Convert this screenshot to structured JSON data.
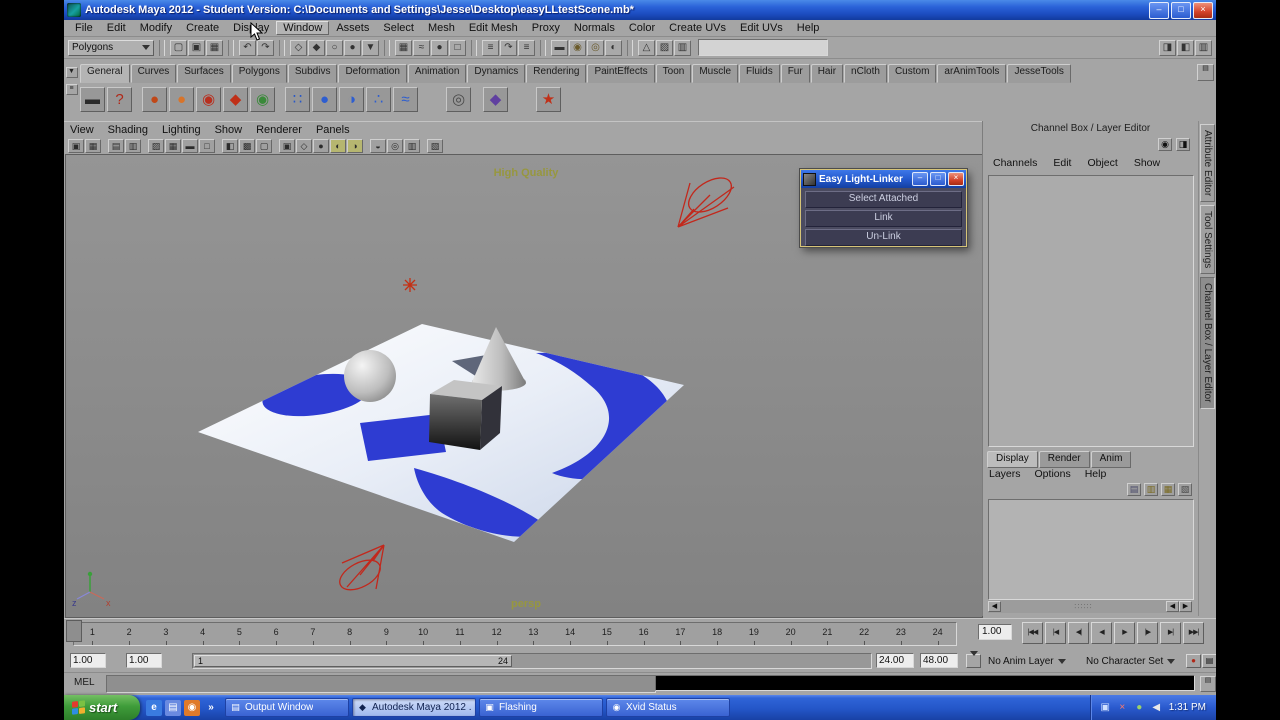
{
  "window": {
    "title": "Autodesk Maya 2012 - Student Version: C:\\Documents and Settings\\Jesse\\Desktop\\easyLLtestScene.mb*",
    "controls": {
      "minimize": "–",
      "maximize": "□",
      "close": "×"
    }
  },
  "menubar": {
    "items": [
      "File",
      "Edit",
      "Modify",
      "Create",
      "Display",
      {
        "label": "Window",
        "name": "menu-window",
        "active": true
      },
      "Assets",
      "Select",
      "Mesh",
      "Edit Mesh",
      "Proxy",
      "Normals",
      "Color",
      "Create UVs",
      "Edit UVs",
      "Help"
    ]
  },
  "statusline": {
    "mode": "Polygons",
    "file_icons": [
      {
        "name": "new-scene-icon",
        "glyph": "▢"
      },
      {
        "name": "open-scene-icon",
        "glyph": "▣"
      },
      {
        "name": "save-scene-icon",
        "glyph": "▦"
      }
    ],
    "undo_icons": [
      {
        "name": "undo-icon",
        "glyph": "↶"
      },
      {
        "name": "redo-icon",
        "glyph": "↷"
      }
    ],
    "mask_icons": [
      {
        "name": "select-hierarchy-icon",
        "glyph": "◇"
      },
      {
        "name": "select-object-icon",
        "glyph": "◆"
      },
      {
        "name": "select-component-icon",
        "glyph": "○"
      },
      {
        "name": "select-mask-icon",
        "glyph": "●"
      },
      {
        "name": "lock-selection-icon",
        "glyph": "▼"
      }
    ],
    "snap_icons": [
      {
        "name": "snap-grid-icon",
        "glyph": "▦"
      },
      {
        "name": "snap-curve-icon",
        "glyph": "≈"
      },
      {
        "name": "snap-point-icon",
        "glyph": "●"
      },
      {
        "name": "snap-plane-icon",
        "glyph": "□"
      }
    ],
    "history_icons": [
      {
        "name": "list-inputs-icon",
        "glyph": "≡"
      },
      {
        "name": "construction-history-icon",
        "glyph": "↷"
      },
      {
        "name": "list-outputs-icon",
        "glyph": "≡"
      }
    ],
    "render_icons": [
      {
        "name": "open-render-view-icon",
        "glyph": "▬"
      },
      {
        "name": "render-current-frame-icon",
        "glyph": "◉",
        "fg": "#6a5a2a"
      },
      {
        "name": "ipr-render-icon",
        "glyph": "◎",
        "fg": "#6a5a2a"
      },
      {
        "name": "render-settings-icon",
        "glyph": "◐"
      }
    ],
    "util_icons": [
      {
        "name": "paint-effects-icon",
        "glyph": "△"
      },
      {
        "name": "hypershade-icon",
        "glyph": "▨"
      },
      {
        "name": "help-line-icon",
        "glyph": "▥"
      }
    ],
    "right_icons": [
      {
        "name": "show-attribute-editor-icon",
        "glyph": "◨"
      },
      {
        "name": "show-tool-settings-icon",
        "glyph": "◧"
      },
      {
        "name": "show-channel-box-icon",
        "glyph": "▥"
      }
    ]
  },
  "shelf": {
    "left_buttons": [
      {
        "name": "shelf-tab-arrow",
        "glyph": "▼"
      },
      {
        "name": "shelf-menu-button",
        "glyph": "≡"
      }
    ],
    "tabs": [
      {
        "label": "General",
        "active": true
      },
      "Curves",
      "Surfaces",
      "Polygons",
      "Subdivs",
      "Deformation",
      "Animation",
      "Dynamics",
      "Rendering",
      "PaintEffects",
      "Toon",
      "Muscle",
      "Fluids",
      "Fur",
      "Hair",
      "nCloth",
      "Custom",
      "arAnimTools",
      "JesseTools"
    ],
    "editor_icon": {
      "glyph": "▤"
    },
    "icons": [
      {
        "name": "shelf-icon-slate",
        "glyph": "▬",
        "fg": "#2a2a2a"
      },
      {
        "name": "shelf-icon-help",
        "glyph": "?",
        "fg": "#b02818"
      },
      {
        "name": "shelf-icon-magnet-red",
        "glyph": "●",
        "fg": "#c04818",
        "gap": 8
      },
      {
        "name": "shelf-icon-magnet-orange",
        "glyph": "●",
        "fg": "#d8742a"
      },
      {
        "name": "shelf-icon-ball-red",
        "glyph": "◉",
        "fg": "#b83020"
      },
      {
        "name": "shelf-icon-comet-red",
        "glyph": "◆",
        "fg": "#c03018"
      },
      {
        "name": "shelf-icon-snap-green",
        "glyph": "◉",
        "fg": "#3a8a3a"
      },
      {
        "name": "shelf-icon-pair-blue",
        "glyph": "∷",
        "fg": "#2858c8",
        "gap": 8
      },
      {
        "name": "shelf-icon-magnet-blue",
        "glyph": "●",
        "fg": "#2e5ed0"
      },
      {
        "name": "shelf-icon-emitter-blue",
        "glyph": "◑",
        "fg": "#2e5ed0"
      },
      {
        "name": "shelf-icon-particles-blue",
        "glyph": "∴",
        "fg": "#2e5ed0"
      },
      {
        "name": "shelf-icon-field-blue",
        "glyph": "≈",
        "fg": "#2e5ed0"
      },
      {
        "name": "shelf-icon-spheres-gray",
        "glyph": "◎",
        "fg": "#4a4a4a",
        "gap": 26
      },
      {
        "name": "shelf-icon-deformer-purple",
        "glyph": "◆",
        "fg": "#6040a0",
        "gap": 10
      },
      {
        "name": "shelf-icon-star-red",
        "glyph": "★",
        "fg": "#c03018",
        "gap": 26
      }
    ]
  },
  "panel_menu": {
    "items": [
      "View",
      "Shading",
      "Lighting",
      "Show",
      "Renderer",
      "Panels"
    ]
  },
  "panel_toolbar": {
    "icons": [
      {
        "name": "single-view-icon",
        "glyph": "▣"
      },
      {
        "name": "four-view-icon",
        "glyph": "▦"
      },
      {
        "name": "camera-attributes-icon",
        "glyph": "▤",
        "gap": 6
      },
      {
        "name": "bookmarks-icon",
        "glyph": "▥"
      },
      {
        "name": "image-plane-icon",
        "glyph": "▨",
        "gap": 6
      },
      {
        "name": "grid-toggle-icon",
        "glyph": "▦"
      },
      {
        "name": "film-gate-icon",
        "glyph": "▬"
      },
      {
        "name": "resolution-gate-icon",
        "glyph": "□"
      },
      {
        "name": "gate-mask-icon",
        "glyph": "◧",
        "gap": 6
      },
      {
        "name": "field-chart-icon",
        "glyph": "▩"
      },
      {
        "name": "safe-action-icon",
        "glyph": "▢"
      },
      {
        "name": "safe-title-icon",
        "glyph": "▣",
        "gap": 6
      },
      {
        "name": "wireframe-mode-icon",
        "glyph": "◇"
      },
      {
        "name": "shaded-mode-icon",
        "glyph": "●"
      },
      {
        "name": "textured-mode-icon",
        "glyph": "◐",
        "bg": "#b6b670"
      },
      {
        "name": "use-all-lights-icon",
        "glyph": "◑",
        "bg": "#b6b670"
      },
      {
        "name": "shadows-icon",
        "glyph": "◒",
        "gap": 6
      },
      {
        "name": "isolate-select-icon",
        "glyph": "◎"
      },
      {
        "name": "xray-icon",
        "glyph": "▥"
      },
      {
        "name": "plugin-shapes-icon",
        "glyph": "▧",
        "gap": 6
      }
    ]
  },
  "viewport": {
    "hud": "High Quality",
    "camera": "persp",
    "axis_x": "x",
    "axis_z": "z"
  },
  "light_linker": {
    "title": "Easy Light-Linker",
    "buttons": [
      {
        "label": "Select Attached",
        "name": "select-attached-button"
      },
      {
        "label": "Link",
        "name": "link-button"
      },
      {
        "label": "Un-Link",
        "name": "unlink-button"
      }
    ]
  },
  "channel_box": {
    "header": "Channel Box / Layer Editor",
    "header_icons": [
      {
        "name": "channel-speed-icon",
        "glyph": "◉"
      },
      {
        "name": "channel-settings-icon",
        "glyph": "◨"
      }
    ],
    "menus": [
      "Channels",
      "Edit",
      "Object",
      "Show"
    ],
    "layer_tabs": [
      {
        "label": "Display",
        "active": true
      },
      {
        "label": "Render"
      },
      {
        "label": "Anim"
      }
    ],
    "layer_menus": [
      "Layers",
      "Options",
      "Help"
    ],
    "layer_icons": [
      {
        "name": "new-empty-layer-icon",
        "glyph": "▤",
        "fg": "#4a4a6a"
      },
      {
        "name": "new-layer-selected-icon",
        "glyph": "▥",
        "fg": "#7a6a20"
      },
      {
        "name": "layer-membership-icon",
        "glyph": "▦",
        "fg": "#7a6a20"
      },
      {
        "name": "layer-options-icon",
        "glyph": "▧",
        "fg": "#4a4a4a"
      }
    ],
    "scroll": {
      "left": "◀",
      "right": "▶",
      "grip": "∷∷∷"
    }
  },
  "side_tabs": [
    {
      "label": "Attribute Editor",
      "name": "side-tab-attribute-editor"
    },
    {
      "label": "Tool Settings",
      "name": "side-tab-tool-settings"
    },
    {
      "label": "Channel Box / Layer Editor",
      "name": "side-tab-channel-box",
      "active": true
    }
  ],
  "timeline": {
    "frames": [
      "1",
      "2",
      "3",
      "4",
      "5",
      "6",
      "7",
      "8",
      "9",
      "10",
      "11",
      "12",
      "13",
      "14",
      "15",
      "16",
      "17",
      "18",
      "19",
      "20",
      "21",
      "22",
      "23",
      "24"
    ],
    "current_time": "1.00",
    "playback": [
      {
        "name": "go-to-start-button",
        "glyph": "|◀◀"
      },
      {
        "name": "step-back-frame-button",
        "glyph": "|◀"
      },
      {
        "name": "step-back-key-button",
        "glyph": "◀|"
      },
      {
        "name": "play-backwards-button",
        "glyph": "◀"
      },
      {
        "name": "play-forwards-button",
        "glyph": "▶"
      },
      {
        "name": "step-forward-key-button",
        "glyph": "|▶"
      },
      {
        "name": "step-forward-frame-button",
        "glyph": "▶|"
      },
      {
        "name": "go-to-end-button",
        "glyph": "▶▶|"
      }
    ]
  },
  "range_slider": {
    "anim_start": "1.00",
    "playback_start": "1.00",
    "bar_start_label": "1",
    "bar_end_label": "24",
    "playback_end": "24.00",
    "anim_end": "48.00",
    "anim_layer": "No Anim Layer",
    "character_set": "No Character Set"
  },
  "command_line": {
    "label": "MEL"
  },
  "taskbar": {
    "start_label": "start",
    "quick_launch": [
      {
        "name": "internet-explorer-icon",
        "glyph": "e",
        "fg": "#ffffff",
        "bg": "#3a7be0"
      },
      {
        "name": "show-desktop-icon",
        "glyph": "▤",
        "fg": "#ffffff",
        "bg": "#6a8ae0"
      },
      {
        "name": "media-player-icon",
        "glyph": "◉",
        "fg": "#ffffff",
        "bg": "#e07a2a"
      },
      {
        "name": "quick-launch-chevron",
        "glyph": "»",
        "fg": "#ffffff"
      }
    ],
    "tasks": [
      {
        "name": "task-output-window",
        "label": "Output Window",
        "glyph": "▤",
        "fg_icon": "#fff"
      },
      {
        "name": "task-maya",
        "label": "Autodesk Maya 2012 ...",
        "glyph": "◆",
        "active": true
      },
      {
        "name": "task-flashing",
        "label": "Flashing",
        "glyph": "▣"
      },
      {
        "name": "task-xvid",
        "label": "Xvid Status",
        "glyph": "◉"
      }
    ],
    "tray_icons": [
      {
        "name": "tray-display-icon",
        "glyph": "▣",
        "fg": "#cfe0ff"
      },
      {
        "name": "tray-xvid-icon",
        "glyph": "×",
        "fg": "#ff7a6a"
      },
      {
        "name": "tray-update-icon",
        "glyph": "●",
        "fg": "#9ad06a"
      },
      {
        "name": "tray-volume-icon",
        "glyph": "◀",
        "fg": "#e8e8e8"
      }
    ],
    "clock": "1:31 PM"
  }
}
